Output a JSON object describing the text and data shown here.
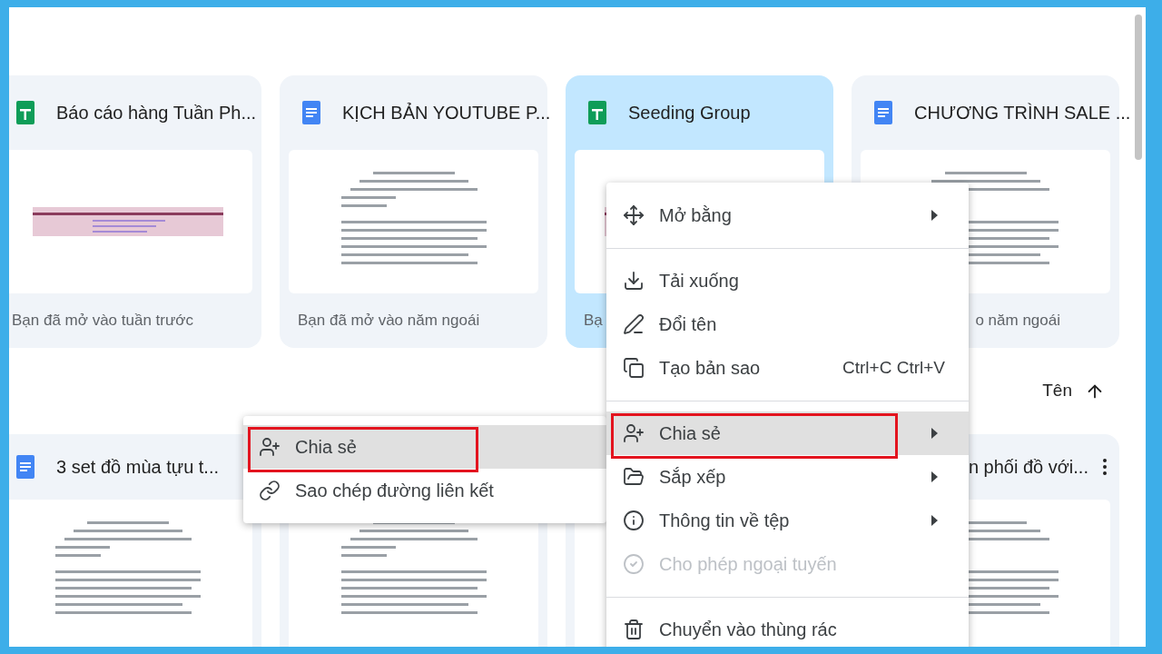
{
  "recent_files": [
    {
      "name": "Báo cáo hàng Tuần Ph...",
      "kind": "sheet",
      "opened": "Bạn đã mở vào tuần trước",
      "selected": false
    },
    {
      "name": "KỊCH BẢN YOUTUBE P...",
      "kind": "doc",
      "opened": "Bạn đã mở vào năm ngoái",
      "selected": false
    },
    {
      "name": "Seeding Group",
      "kind": "sheet",
      "opened": "Bạ",
      "selected": true
    },
    {
      "name": "CHƯƠNG TRÌNH SALE ...",
      "kind": "doc",
      "opened": "o năm ngoái",
      "selected": false
    }
  ],
  "sort": {
    "label": "Tên"
  },
  "files": [
    {
      "name": "3 set đồ mùa tựu t...",
      "kind": "doc"
    },
    {
      "kind": "preview"
    },
    {
      "kind": "preview"
    },
    {
      "name": "n phối đồ với...",
      "kind": "doc"
    }
  ],
  "context_menu": {
    "items": [
      {
        "kind": "item",
        "label": "Mở bằng",
        "submenu": true,
        "disabled": false,
        "highlighted": false,
        "annotated": false
      },
      {
        "kind": "divider"
      },
      {
        "kind": "item",
        "label": "Tải xuống",
        "submenu": false,
        "disabled": false,
        "highlighted": false,
        "annotated": false
      },
      {
        "kind": "item",
        "label": "Đổi tên",
        "submenu": false,
        "disabled": false,
        "highlighted": false,
        "annotated": false
      },
      {
        "kind": "item",
        "label": "Tạo bản sao",
        "shortcut": "Ctrl+C Ctrl+V",
        "submenu": false,
        "disabled": false,
        "highlighted": false,
        "annotated": false
      },
      {
        "kind": "divider"
      },
      {
        "kind": "item",
        "label": "Chia sẻ",
        "submenu": true,
        "disabled": false,
        "highlighted": true,
        "annotated": true
      },
      {
        "kind": "item",
        "label": "Sắp xếp",
        "submenu": true,
        "disabled": false,
        "highlighted": false,
        "annotated": false
      },
      {
        "kind": "item",
        "label": "Thông tin về tệp",
        "submenu": true,
        "disabled": false,
        "highlighted": false,
        "annotated": false
      },
      {
        "kind": "item",
        "label": "Cho phép ngoại tuyến",
        "submenu": false,
        "disabled": true,
        "highlighted": false,
        "annotated": false
      },
      {
        "kind": "divider"
      },
      {
        "kind": "item",
        "label": "Chuyển vào thùng rác",
        "submenu": false,
        "disabled": false,
        "highlighted": false,
        "annotated": false
      }
    ]
  },
  "share_submenu": {
    "items": [
      {
        "label": "Chia sẻ",
        "highlighted": true,
        "annotated": true
      },
      {
        "label": "Sao chép đường liên kết",
        "highlighted": false,
        "annotated": false
      }
    ]
  }
}
